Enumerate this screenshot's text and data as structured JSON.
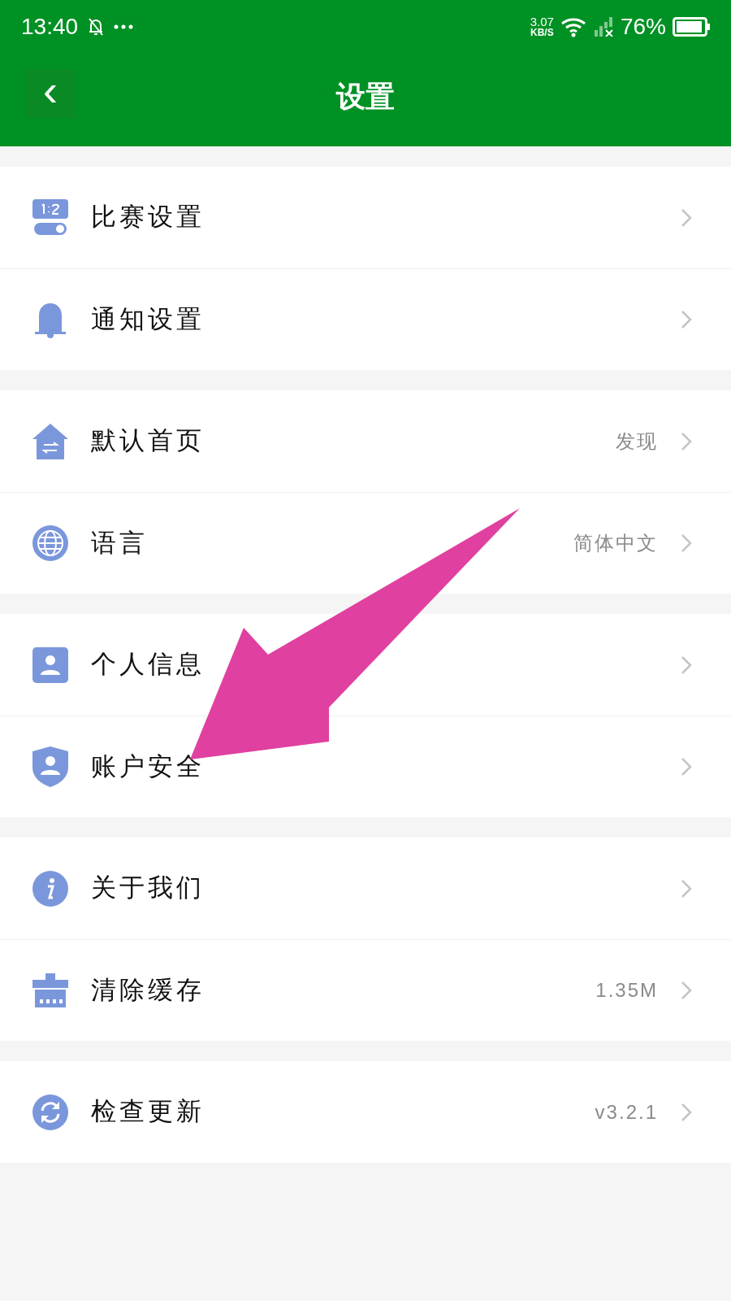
{
  "status_bar": {
    "time": "13:40",
    "speed_value": "3.07",
    "speed_unit": "KB/S",
    "battery": "76%"
  },
  "header": {
    "back": "‹",
    "title": "设置"
  },
  "groups": [
    {
      "rows": [
        {
          "label": "比赛设置"
        },
        {
          "label": "通知设置"
        }
      ]
    },
    {
      "rows": [
        {
          "label": "默认首页",
          "value": "发现"
        },
        {
          "label": "语言",
          "value": "简体中文"
        }
      ]
    },
    {
      "rows": [
        {
          "label": "个人信息"
        },
        {
          "label": "账户安全"
        }
      ]
    },
    {
      "rows": [
        {
          "label": "关于我们"
        },
        {
          "label": "清除缓存",
          "value": "1.35M"
        }
      ]
    },
    {
      "rows": [
        {
          "label": "检查更新",
          "value": "v3.2.1"
        }
      ]
    }
  ]
}
